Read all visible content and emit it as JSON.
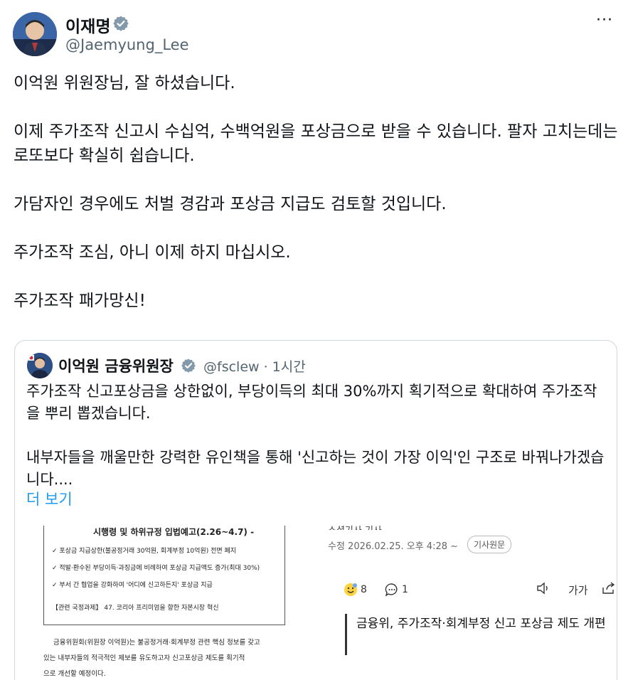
{
  "author": {
    "name": "이재명",
    "handle": "@Jaemyung_Lee"
  },
  "menu": {
    "more_label": "···"
  },
  "tweet": {
    "paragraphs": [
      "이억원 위원장님, 잘 하셨습니다.",
      "이제 주가조작 신고시 수십억, 수백억원을 포상금으로 받을 수 있습니다. 팔자 고치는데는 로또보다 확실히 쉽습니다.",
      "가담자인 경우에도 처벌 경감과 포상금 지급도 검토할 것입니다.",
      "주가조작 조심, 아니 이제 하지 마십시오.",
      "주가조작 패가망신!"
    ]
  },
  "quote": {
    "name": "이억원 금융위원장",
    "handle_time": "@fsclew · 1시간",
    "paragraphs": [
      "주가조작 신고포상금을 상한없이, 부당이득의 최대 30%까지 획기적으로 확대하여 주가조작을 뿌리 뽑겠습니다.",
      "내부자들을 깨울만한 강력한 유인책을 통해 '신고하는 것이 가장 이익'인 구조로 바꿔나가겠습니다...."
    ],
    "show_more": "더 보기"
  },
  "media": {
    "doc": {
      "heading": "시행령 및 하위규정 입법예고(2.26~4.7) -",
      "lines": [
        "✓ 포상금 지급상한(불공정거래 30억원, 회계부정 10억원) 전면 폐지",
        "✓ 적발·환수된 부당이득·과징금에 비례하여 포상금 지급액도 증가(최대 30%)",
        "✓ 부서 간 협업을 강화하여 '어디에 신고하든지' 포상금 지급",
        "【관련 국정과제】 47. 코리아 프리미엄을 향한 자본시장 혁신"
      ],
      "body": [
        "금융위원회(위원장 이억원)는 불공정거래·회계부정 관련 핵심 정보를 갖고",
        "있는 내부자들의 적극적인 제보를 유도하고자 신고포상금 제도를 획기적",
        "으로 개선할 예정이다."
      ]
    },
    "news": {
      "cut_text": "소셜기사 기사",
      "meta": "수정 2026.02.25. 오후 4:28 ~",
      "badge": "기사원문",
      "reaction_count": "8",
      "comment_count": "1",
      "font_label": "가가",
      "headline": "금융위, 주가조작·회계부정 신고 포상금 제도 개편"
    }
  },
  "colors": {
    "text": "#0f1419",
    "muted": "#536471",
    "link": "#1d9bf0",
    "verified": "#829aab",
    "border": "#cfd9de"
  }
}
